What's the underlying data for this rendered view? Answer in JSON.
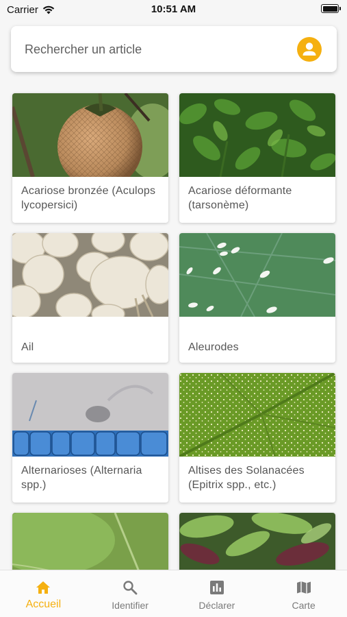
{
  "status_bar": {
    "carrier": "Carrier",
    "time": "10:51 AM"
  },
  "search": {
    "placeholder": "Rechercher un article"
  },
  "colors": {
    "accent": "#f5b010",
    "tab_inactive": "#7a7a7a"
  },
  "articles": [
    {
      "title": "Acariose bronzée (Aculops lycopersici)"
    },
    {
      "title": "Acariose déformante (tarsonème)"
    },
    {
      "title": "Ail"
    },
    {
      "title": "Aleurodes"
    },
    {
      "title": "Alternarioses (Alternaria spp.)"
    },
    {
      "title": "Altises des Solanacées (Epitrix spp., etc.)"
    },
    {
      "title": ""
    },
    {
      "title": ""
    }
  ],
  "tabs": [
    {
      "label": "Accueil",
      "icon": "home-icon",
      "active": true
    },
    {
      "label": "Identifier",
      "icon": "search-icon",
      "active": false
    },
    {
      "label": "Déclarer",
      "icon": "chart-icon",
      "active": false
    },
    {
      "label": "Carte",
      "icon": "map-icon",
      "active": false
    }
  ]
}
